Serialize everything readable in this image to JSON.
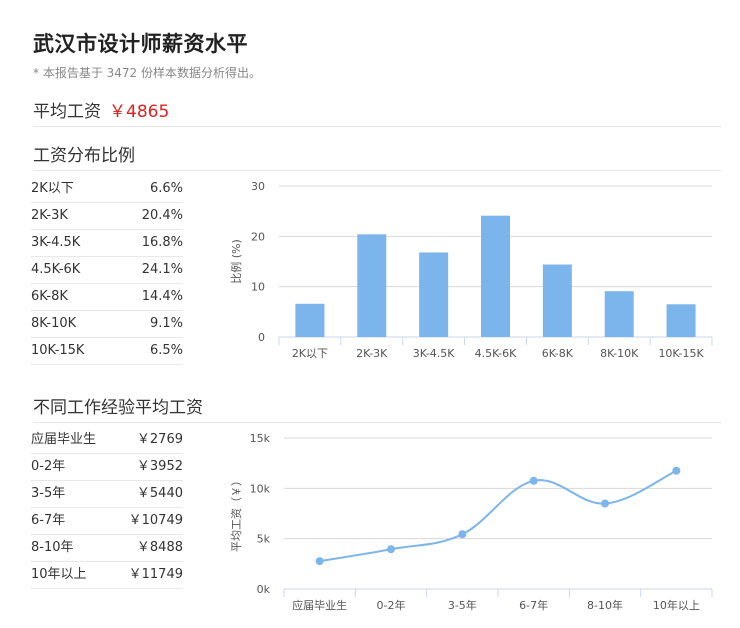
{
  "page": {
    "title": "武汉市设计师薪资水平",
    "subtitle": "* 本报告基于 3472 份样本数据分析得出。"
  },
  "average": {
    "label": "平均工资",
    "value": "￥4865"
  },
  "distribution": {
    "heading": "工资分布比例",
    "rows": [
      {
        "label": "2K以下",
        "value": "6.6%"
      },
      {
        "label": "2K-3K",
        "value": "20.4%"
      },
      {
        "label": "3K-4.5K",
        "value": "16.8%"
      },
      {
        "label": "4.5K-6K",
        "value": "24.1%"
      },
      {
        "label": "6K-8K",
        "value": "14.4%"
      },
      {
        "label": "8K-10K",
        "value": "9.1%"
      },
      {
        "label": "10K-15K",
        "value": "6.5%"
      }
    ]
  },
  "experience": {
    "heading": "不同工作经验平均工资",
    "rows": [
      {
        "label": "应届毕业生",
        "value": "￥2769"
      },
      {
        "label": "0-2年",
        "value": "￥3952"
      },
      {
        "label": "3-5年",
        "value": "￥5440"
      },
      {
        "label": "6-7年",
        "value": "￥10749"
      },
      {
        "label": "8-10年",
        "value": "￥8488"
      },
      {
        "label": "10年以上",
        "value": "￥11749"
      }
    ]
  },
  "colors": {
    "series": "#7cb5ec",
    "accent": "#e02020",
    "grid": "#d8d8d8"
  },
  "chart_data": [
    {
      "type": "bar",
      "categories": [
        "2K以下",
        "2K-3K",
        "3K-4.5K",
        "4.5K-6K",
        "6K-8K",
        "8K-10K",
        "10K-15K"
      ],
      "values": [
        6.6,
        20.4,
        16.8,
        24.1,
        14.4,
        9.1,
        6.5
      ],
      "ylabel": "比例 (%)",
      "ylim": [
        0,
        30
      ],
      "yticks": [
        "0",
        "10",
        "20",
        "30"
      ],
      "yticks_values": [
        0,
        10,
        20,
        30
      ],
      "grid": true,
      "legend": "none"
    },
    {
      "type": "line",
      "categories": [
        "应届毕业生",
        "0-2年",
        "3-5年",
        "6-7年",
        "8-10年",
        "10年以上"
      ],
      "values": [
        2769,
        3952,
        5440,
        10749,
        8488,
        11749
      ],
      "ylabel": "平均工资（￥）",
      "ylim": [
        0,
        15000
      ],
      "yticks": [
        "0k",
        "5k",
        "10k",
        "15k"
      ],
      "yticks_values": [
        0,
        5000,
        10000,
        15000
      ],
      "smooth": true,
      "grid": true,
      "legend": "none"
    }
  ]
}
